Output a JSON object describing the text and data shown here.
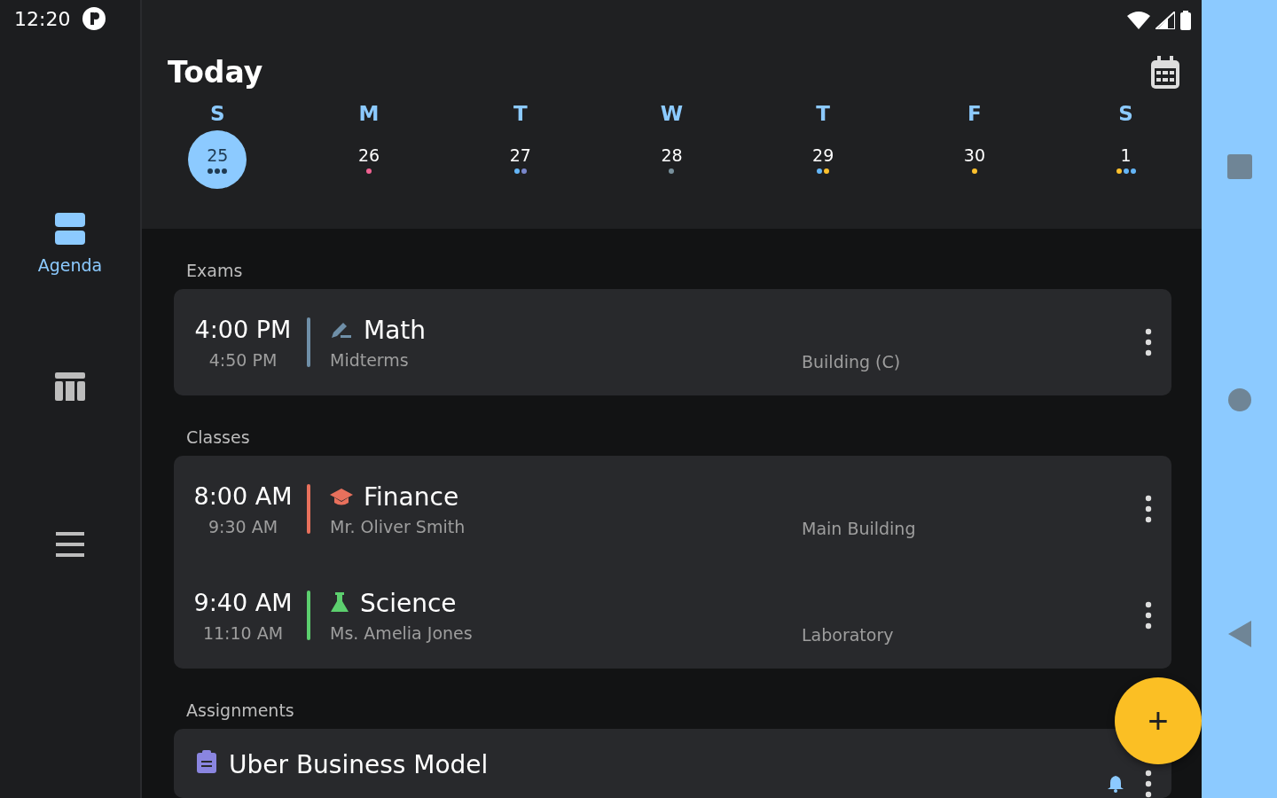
{
  "status_bar": {
    "time": "12:20"
  },
  "rail": {
    "items": [
      {
        "kind": "agenda",
        "label": "Agenda",
        "selected": true
      },
      {
        "kind": "timetable",
        "selected": false
      },
      {
        "kind": "list",
        "selected": false
      }
    ]
  },
  "header": {
    "title": "Today"
  },
  "week": [
    {
      "letter": "S",
      "date": "25",
      "selected": true,
      "dots": [
        {
          "color": "#1f3a52"
        },
        {
          "color": "#1f3a52"
        },
        {
          "color": "#1f3a52"
        }
      ]
    },
    {
      "letter": "M",
      "date": "26",
      "selected": false,
      "dots": [
        {
          "color": "#f06292"
        }
      ]
    },
    {
      "letter": "T",
      "date": "27",
      "selected": false,
      "dots": [
        {
          "color": "#64b5f6"
        },
        {
          "color": "#7986cb"
        }
      ]
    },
    {
      "letter": "W",
      "date": "28",
      "selected": false,
      "dots": [
        {
          "color": "#78909c"
        }
      ]
    },
    {
      "letter": "T",
      "date": "29",
      "selected": false,
      "dots": [
        {
          "color": "#64b5f6"
        },
        {
          "color": "#fbc02d"
        }
      ]
    },
    {
      "letter": "F",
      "date": "30",
      "selected": false,
      "dots": [
        {
          "color": "#fbc02d"
        }
      ]
    },
    {
      "letter": "S",
      "date": "1",
      "selected": false,
      "dots": [
        {
          "color": "#fbc02d"
        },
        {
          "color": "#64b5f6"
        },
        {
          "color": "#64b5f6"
        }
      ]
    }
  ],
  "sections": [
    {
      "title": "Exams",
      "events": [
        {
          "kind": "exam",
          "start": "4:00 PM",
          "end": "4:50 PM",
          "title": "Math",
          "subtitle": "Midterms",
          "location": "Building (C)",
          "color": "#6f8fa8"
        }
      ]
    },
    {
      "title": "Classes",
      "events": [
        {
          "kind": "class",
          "start": "8:00 AM",
          "end": "9:30 AM",
          "title": "Finance",
          "subtitle": "Mr. Oliver Smith",
          "location": "Main Building",
          "color": "#e8705c"
        },
        {
          "kind": "lab",
          "start": "9:40 AM",
          "end": "11:10 AM",
          "title": "Science",
          "subtitle": "Ms. Amelia Jones",
          "location": "Laboratory",
          "color": "#5ccf6e"
        }
      ]
    },
    {
      "title": "Assignments",
      "tasks": [
        {
          "title": "Uber Business Model",
          "color": "#8a85e0",
          "reminder": true
        }
      ]
    }
  ],
  "fab": {
    "label": "+"
  }
}
